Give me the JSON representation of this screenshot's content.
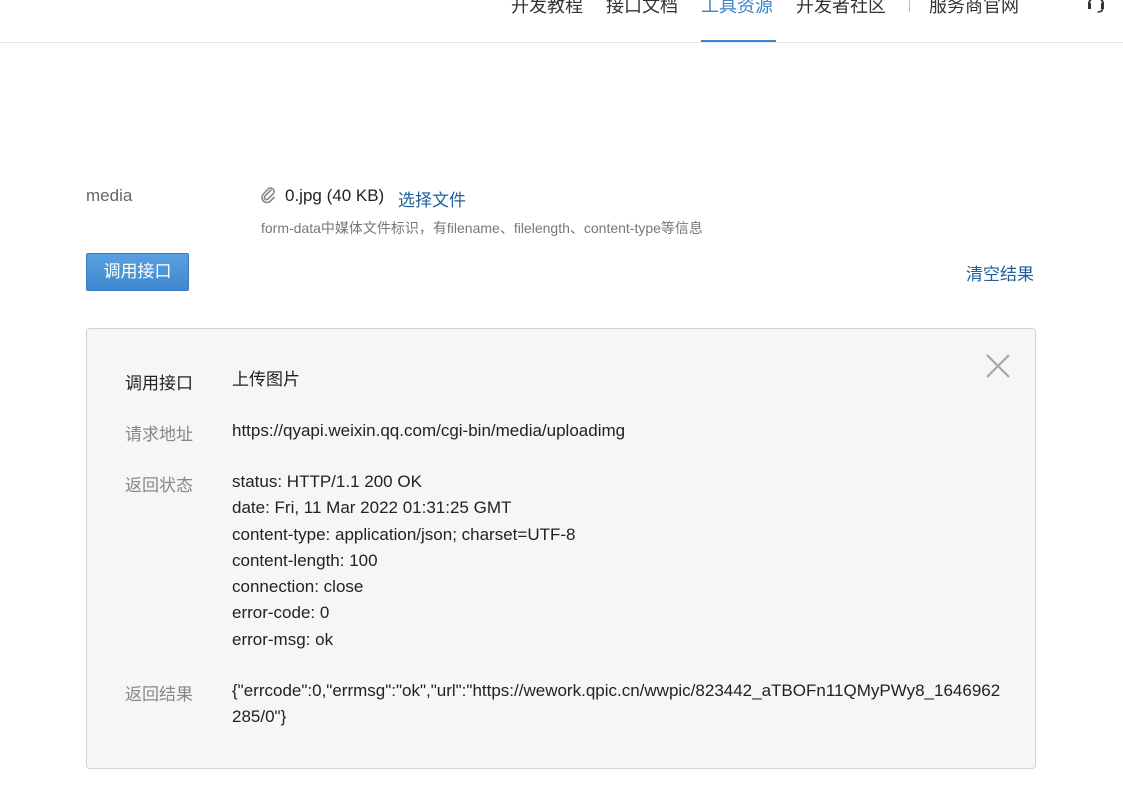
{
  "nav": {
    "items": [
      {
        "label": "开发教程",
        "active": false
      },
      {
        "label": "接口文档",
        "active": false
      },
      {
        "label": "工具资源",
        "active": true
      },
      {
        "label": "开发者社区",
        "active": false
      },
      {
        "label": "服务商官网",
        "active": false
      }
    ],
    "accent_color": "#3b82cf"
  },
  "param": {
    "label": "media",
    "file_name": "0.jpg (40 KB)",
    "choose_file": "选择文件",
    "description": "form-data中媒体文件标识，有filename、filelength、content-type等信息"
  },
  "actions": {
    "call_button": "调用接口",
    "clear_link": "清空结果"
  },
  "result": {
    "api_label": "调用接口",
    "api_value": "上传图片",
    "url_label": "请求地址",
    "url_value": "https://qyapi.weixin.qq.com/cgi-bin/media/uploadimg",
    "status_label": "返回状态",
    "status_lines": [
      "status: HTTP/1.1 200 OK",
      "date: Fri, 11 Mar 2022 01:31:25 GMT",
      "content-type: application/json; charset=UTF-8",
      "content-length: 100",
      "connection: close",
      "error-code: 0",
      "error-msg: ok"
    ],
    "body_label": "返回结果",
    "body_value": "{\"errcode\":0,\"errmsg\":\"ok\",\"url\":\"https://wework.qpic.cn/wwpic/823442_aTBOFn11QMyPWy8_1646962285/0\"}"
  }
}
